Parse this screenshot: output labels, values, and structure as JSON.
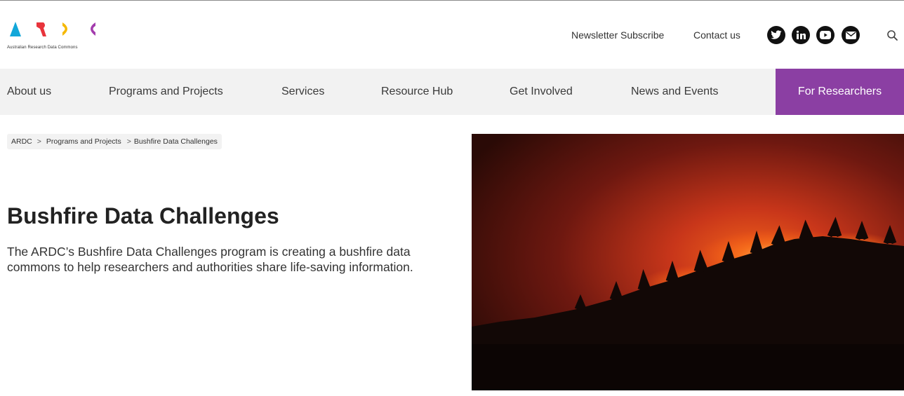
{
  "header": {
    "logo_letters": [
      "A",
      "R",
      "D",
      "C"
    ],
    "logo_tagline": "Australian Research Data Commons",
    "utility_links": [
      "Newsletter Subscribe",
      "Contact us"
    ],
    "social_icons": [
      "twitter-icon",
      "linkedin-icon",
      "youtube-icon",
      "email-icon"
    ],
    "search_icon": "search-icon"
  },
  "nav": {
    "items": [
      "About us",
      "Programs and Projects",
      "Services",
      "Resource Hub",
      "Get Involved",
      "News and Events",
      "For Researchers"
    ],
    "active": "For Researchers"
  },
  "breadcrumb": {
    "items": [
      "ARDC",
      "Programs and Projects",
      "Bushfire Data Challenges"
    ],
    "separator": ">"
  },
  "main": {
    "title": "Bushfire Data Challenges",
    "intro": "The ARDC’s Bushfire Data Challenges program is creating a bushfire data commons to help researchers and authorities share life-saving information."
  },
  "colors": {
    "logo_a": "#13a7d9",
    "logo_r": "#e8343c",
    "logo_d": "#f5b800",
    "logo_c": "#a33cad",
    "nav_active": "#8b3fa3",
    "nav_bg": "#f2f2f2"
  }
}
